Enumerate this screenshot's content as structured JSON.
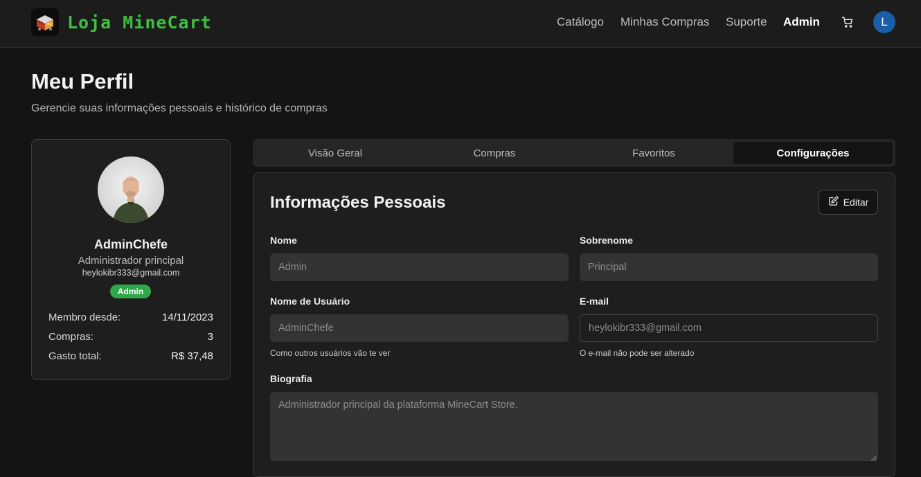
{
  "header": {
    "brand_name": "Loja MineCart",
    "logo_icon": "minecart-chest-icon",
    "nav": [
      {
        "label": "Catálogo"
      },
      {
        "label": "Minhas Compras"
      },
      {
        "label": "Suporte"
      },
      {
        "label": "Admin",
        "active": true
      }
    ],
    "cart_icon": "shopping-cart-icon",
    "avatar_initial": "L",
    "avatar_color": "#1a5ea8"
  },
  "page": {
    "title": "Meu Perfil",
    "subtitle": "Gerencie suas informações pessoais e histórico de compras"
  },
  "profile": {
    "name": "AdminChefe",
    "role": "Administrador principal",
    "email": "heylokibr333@gmail.com",
    "badge": "Admin",
    "badge_color": "#2ea84a",
    "stats": [
      {
        "label": "Membro desde:",
        "value": "14/11/2023"
      },
      {
        "label": "Compras:",
        "value": "3"
      },
      {
        "label": "Gasto total:",
        "value": "R$ 37,48"
      }
    ]
  },
  "tabs": [
    {
      "label": "Visão Geral"
    },
    {
      "label": "Compras"
    },
    {
      "label": "Favoritos"
    },
    {
      "label": "Configurações",
      "active": true
    }
  ],
  "info": {
    "title": "Informações Pessoais",
    "edit_label": "Editar",
    "edit_icon": "edit-pencil-square-icon",
    "fields": {
      "first_name": {
        "label": "Nome",
        "value": "Admin"
      },
      "last_name": {
        "label": "Sobrenome",
        "value": "Principal"
      },
      "username": {
        "label": "Nome de Usuário",
        "value": "AdminChefe",
        "help": "Como outros usuários vão te ver"
      },
      "email": {
        "label": "E-mail",
        "value": "heylokibr333@gmail.com",
        "help": "O e-mail não pode ser alterado"
      },
      "bio": {
        "label": "Biografia",
        "value": "Administrador principal da plataforma MineCart Store."
      }
    }
  },
  "colors": {
    "brand_green": "#3fbf3f",
    "background": "#141414",
    "card": "#1e1e1e"
  }
}
